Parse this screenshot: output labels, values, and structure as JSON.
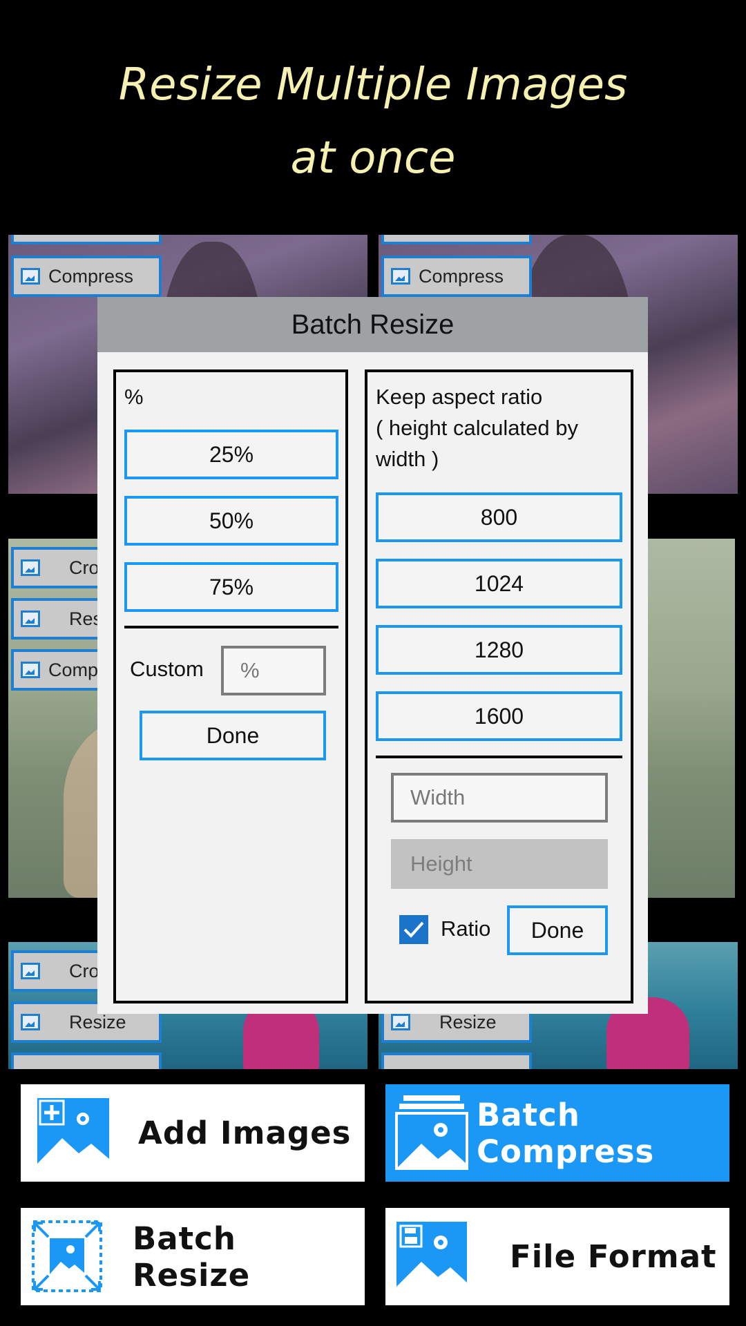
{
  "headline": {
    "line1": "Resize Multiple Images",
    "line2": "at once"
  },
  "background_tiles": {
    "tags": {
      "compress": "Compress",
      "crop": "Cro",
      "resize_partial": "Resiz",
      "compress_partial": "Comp",
      "resize": "Resize"
    }
  },
  "dialog": {
    "title": "Batch Resize",
    "percent_panel": {
      "heading": "%",
      "options": [
        "25%",
        "50%",
        "75%"
      ],
      "custom_label": "Custom",
      "custom_placeholder": "%",
      "done_label": "Done"
    },
    "size_panel": {
      "heading_line1": "Keep aspect ratio",
      "heading_line2": "( height calculated by",
      "heading_line3": "width )",
      "options": [
        "800",
        "1024",
        "1280",
        "1600"
      ],
      "width_placeholder": "Width",
      "height_placeholder": "Height",
      "ratio_label": "Ratio",
      "ratio_checked": true,
      "done_label": "Done"
    }
  },
  "actions": {
    "add_images": "Add Images",
    "batch_compress": "Batch Compress",
    "batch_resize": "Batch Resize",
    "file_format": "File Format"
  },
  "colors": {
    "accent": "#1b98f5",
    "headline": "#f6f1b0"
  }
}
